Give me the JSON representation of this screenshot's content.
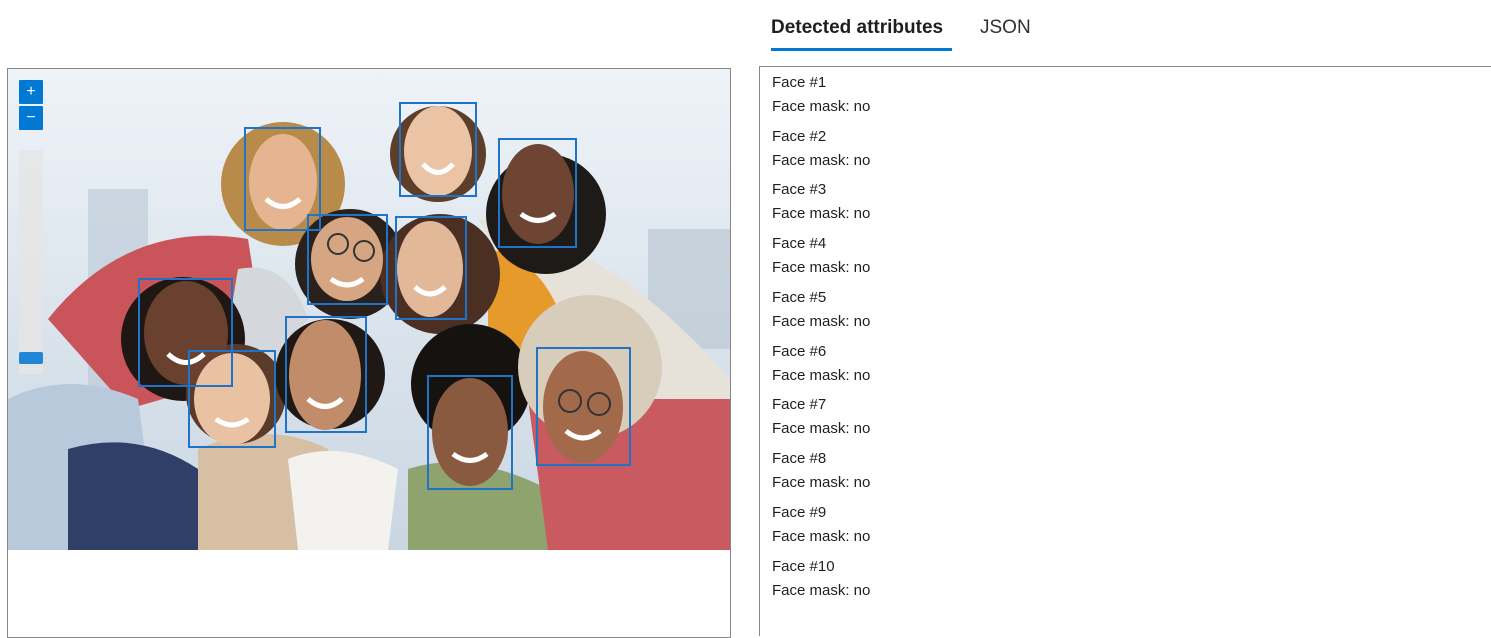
{
  "tabs": [
    {
      "label": "Detected attributes",
      "active": true
    },
    {
      "label": "JSON",
      "active": false
    }
  ],
  "viewer": {
    "zoom_in_icon": "plus-icon",
    "zoom_out_icon": "minus-icon",
    "zoom_in_label": "+",
    "zoom_out_label": "−",
    "box_color": "#1f74c8"
  },
  "faces": [
    {
      "title": "Face #1",
      "mask_label": "Face mask: no"
    },
    {
      "title": "Face #2",
      "mask_label": "Face mask: no"
    },
    {
      "title": "Face #3",
      "mask_label": "Face mask: no"
    },
    {
      "title": "Face #4",
      "mask_label": "Face mask: no"
    },
    {
      "title": "Face #5",
      "mask_label": "Face mask: no"
    },
    {
      "title": "Face #6",
      "mask_label": "Face mask: no"
    },
    {
      "title": "Face #7",
      "mask_label": "Face mask: no"
    },
    {
      "title": "Face #8",
      "mask_label": "Face mask: no"
    },
    {
      "title": "Face #9",
      "mask_label": "Face mask: no"
    },
    {
      "title": "Face #10",
      "mask_label": "Face mask: no"
    }
  ],
  "colors": {
    "accent": "#0078d4",
    "face_box": "#1f74c8"
  }
}
